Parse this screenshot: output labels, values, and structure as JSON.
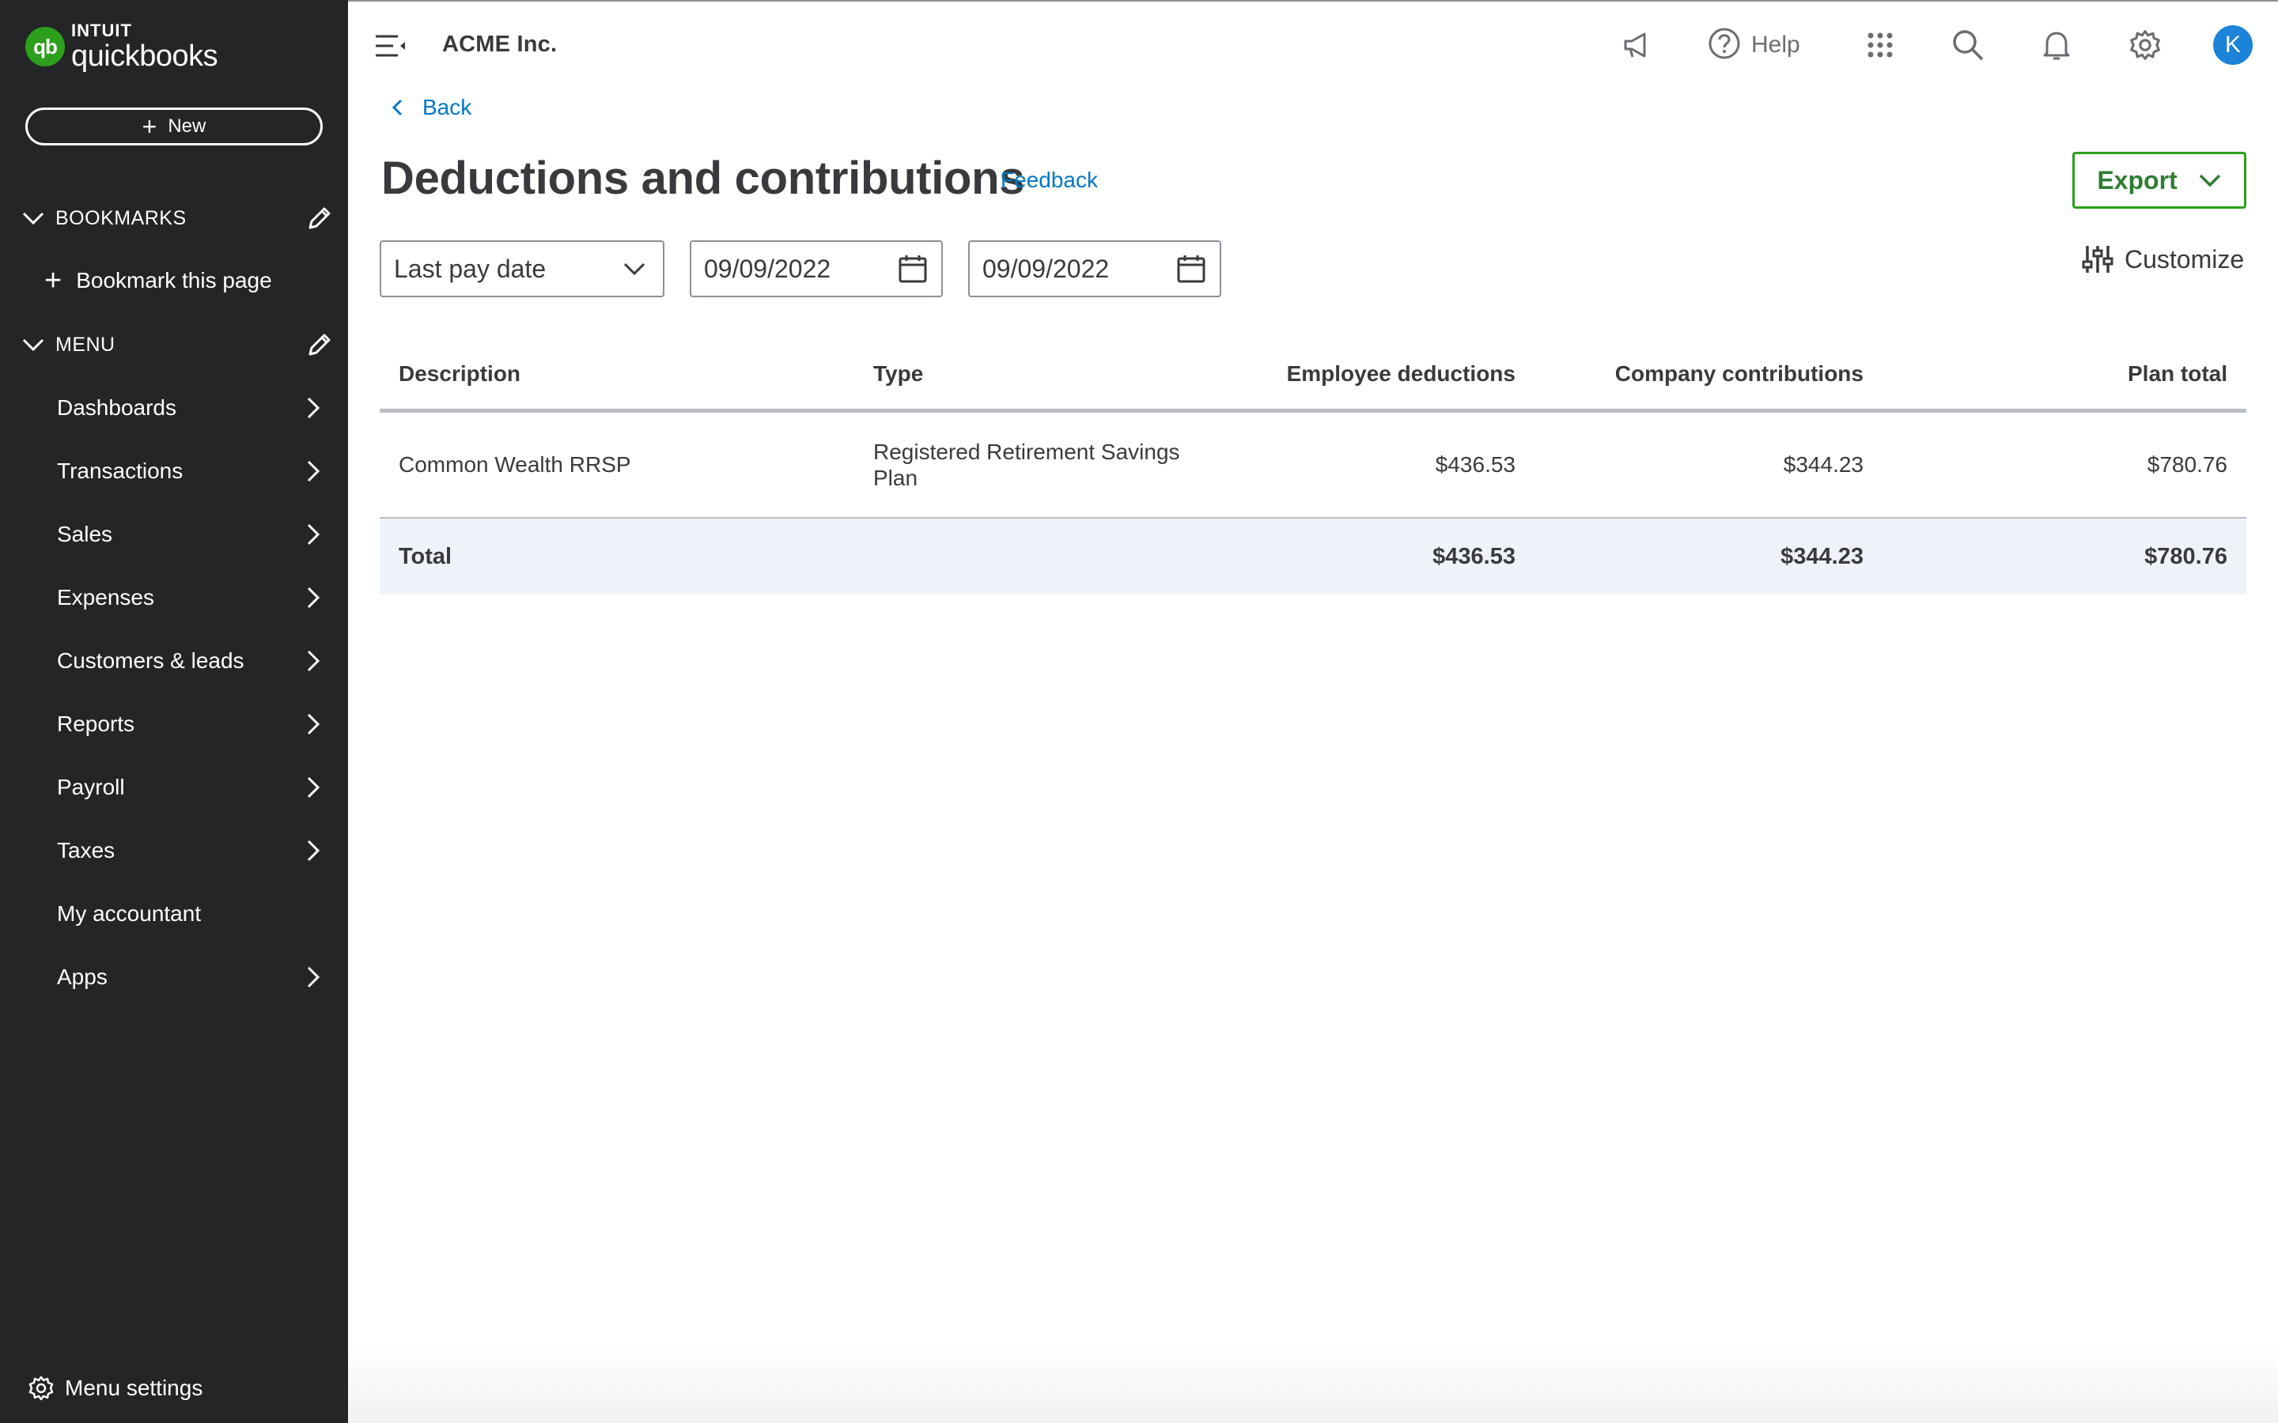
{
  "app": {
    "brand_top": "INTUIT",
    "brand_bottom": "quickbooks",
    "logo_mark": "qb"
  },
  "sidebar": {
    "new_button": "New",
    "bookmarks_heading": "BOOKMARKS",
    "bookmark_this_page": "Bookmark this page",
    "menu_heading": "MENU",
    "items": [
      {
        "label": "Dashboards",
        "has_chevron": true
      },
      {
        "label": "Transactions",
        "has_chevron": true
      },
      {
        "label": "Sales",
        "has_chevron": true
      },
      {
        "label": "Expenses",
        "has_chevron": true
      },
      {
        "label": "Customers & leads",
        "has_chevron": true
      },
      {
        "label": "Reports",
        "has_chevron": true
      },
      {
        "label": "Payroll",
        "has_chevron": true
      },
      {
        "label": "Taxes",
        "has_chevron": true
      },
      {
        "label": "My accountant",
        "has_chevron": false
      },
      {
        "label": "Apps",
        "has_chevron": true
      }
    ],
    "menu_settings": "Menu settings"
  },
  "topbar": {
    "company_name": "ACME Inc.",
    "help_label": "Help",
    "avatar_initial": "K",
    "icons": [
      "megaphone-icon",
      "help-icon",
      "apps-grid-icon",
      "search-icon",
      "bell-icon",
      "gear-icon"
    ]
  },
  "page": {
    "back_label": "Back",
    "title": "Deductions and contributions",
    "feedback_label": "Feedback",
    "export_label": "Export",
    "customize_label": "Customize",
    "filters": {
      "date_type": "Last pay date",
      "start_date": "09/09/2022",
      "end_date": "09/09/2022"
    }
  },
  "table": {
    "headers": [
      "Description",
      "Type",
      "Employee deductions",
      "Company contributions",
      "Plan total"
    ],
    "rows": [
      {
        "description": "Common Wealth RRSP",
        "type": "Registered Retirement Savings Plan",
        "employee_deductions": "$436.53",
        "company_contributions": "$344.23",
        "plan_total": "$780.76"
      }
    ],
    "total": {
      "label": "Total",
      "employee_deductions": "$436.53",
      "company_contributions": "$344.23",
      "plan_total": "$780.76"
    }
  },
  "colors": {
    "sidebar_bg": "#242526",
    "brand_green": "#2ca01c",
    "link_blue": "#0077c5",
    "avatar_blue": "#1b83d8",
    "total_row_bg": "#eff3f9"
  }
}
